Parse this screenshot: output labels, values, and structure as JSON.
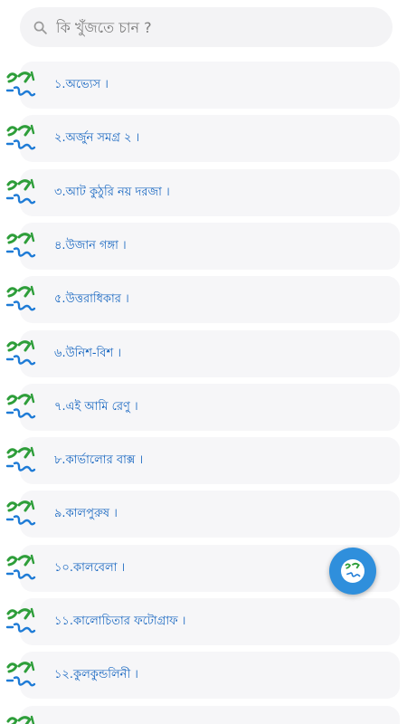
{
  "search": {
    "placeholder": "কি খুঁজতে চান ?"
  },
  "list": {
    "logo_icon": "boi-tong-logo-icon",
    "items": [
      {
        "label": "১.অভ্যেস ।"
      },
      {
        "label": "২.অর্জুন সমগ্র ২ ।"
      },
      {
        "label": "৩.আট কুঠুরি নয় দরজা ।"
      },
      {
        "label": "৪.উজান গঙ্গা ।"
      },
      {
        "label": "৫.উত্তরাধিকার ।"
      },
      {
        "label": "৬.উনিশ-বিশ ।"
      },
      {
        "label": "৭.এই আমি রেণু ।"
      },
      {
        "label": "৮.কার্ভালোর বাক্স ।"
      },
      {
        "label": "৯.কালপুরুষ ।"
      },
      {
        "label": "১০.কালবেলা ।"
      },
      {
        "label": "১১.কালোচিতার ফটোগ্রাফ ।"
      },
      {
        "label": "১২.কুলকুন্ডলিনী ।"
      },
      {
        "label": ""
      }
    ]
  },
  "fab": {
    "icon": "boi-tong-logo-icon"
  },
  "colors": {
    "item_text": "#1565c0",
    "card_bg": "#f6f6f8",
    "fab_bg": "#2f8fdc",
    "logo_green": "#2e9e3a",
    "logo_blue": "#1e7bd6"
  }
}
